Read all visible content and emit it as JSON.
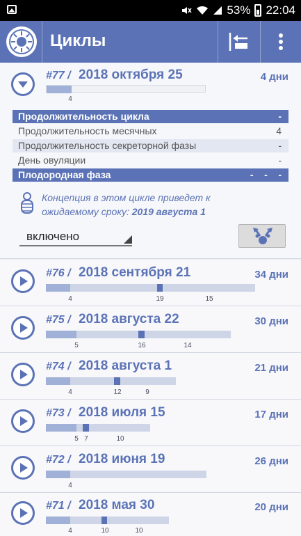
{
  "status_bar": {
    "battery": "53%",
    "time": "22:04"
  },
  "app_bar": {
    "title": "Циклы"
  },
  "expanded_cycle": {
    "number": "#77 /",
    "date": "2018 октября 25",
    "days": "4 дни",
    "bar_tick": "4",
    "details": [
      {
        "label": "Продолжительность цикла",
        "value": "-"
      },
      {
        "label": "Продолжительность месячных",
        "value": "4"
      },
      {
        "label": "Продолжительность секреторной фазы",
        "value": "-"
      },
      {
        "label": "День овуляции",
        "value": "-"
      },
      {
        "label": "Плодородная фаза",
        "value": "-    -    -"
      }
    ],
    "conception_text": "Концепция в этом цикле приведет к ожидаемому сроку:",
    "conception_date": "2019 августа 1",
    "select_value": "включено"
  },
  "cycles": [
    {
      "number": "#76 /",
      "date": "2018 сентября 21",
      "days": "34 дни",
      "ticks": [
        "4",
        "19",
        "15"
      ]
    },
    {
      "number": "#75 /",
      "date": "2018 августа 22",
      "days": "30 дни",
      "ticks": [
        "5",
        "16",
        "14"
      ]
    },
    {
      "number": "#74 /",
      "date": "2018 августа 1",
      "days": "21 дни",
      "ticks": [
        "4",
        "12",
        "9"
      ]
    },
    {
      "number": "#73 /",
      "date": "2018 июля 15",
      "days": "17 дни",
      "ticks": [
        "5",
        "7",
        "10"
      ]
    },
    {
      "number": "#72 /",
      "date": "2018 июня 19",
      "days": "26 дни",
      "ticks": [
        "4"
      ]
    },
    {
      "number": "#71 /",
      "date": "2018 мая 30",
      "days": "20 дни",
      "ticks": [
        "4",
        "10",
        "10"
      ]
    }
  ],
  "colors": {
    "primary": "#5b73b6",
    "bar_bg": "#ced5e6",
    "period": "#a0b0d6"
  }
}
